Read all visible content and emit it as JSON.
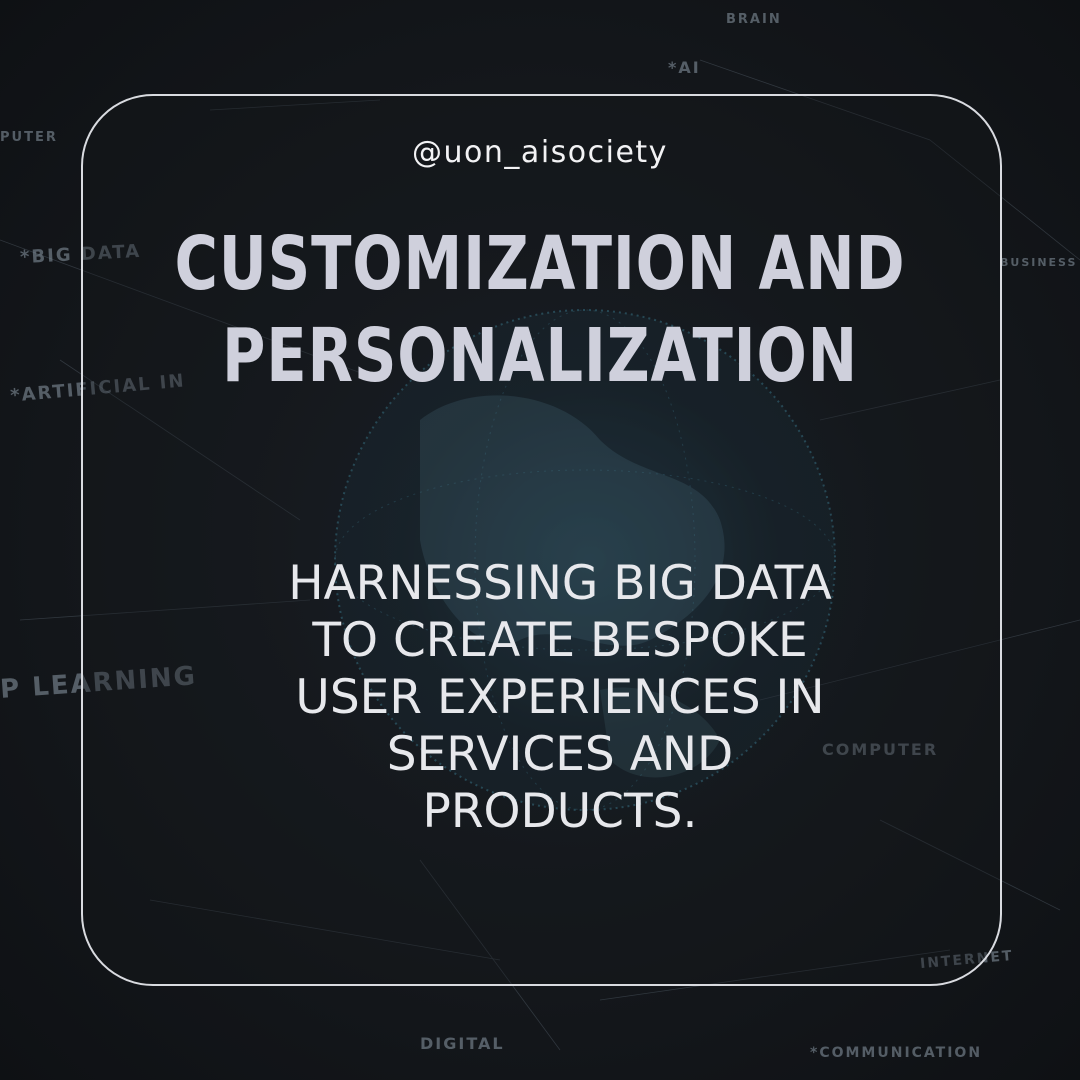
{
  "handle": "@uon_aisociety",
  "title_lines": [
    "CUSTOMIZATION AND",
    "PERSONALIZATION"
  ],
  "body_lines": [
    "HARNESSING BIG DATA",
    "TO CREATE BESPOKE",
    "USER EXPERIENCES IN",
    "SERVICES AND",
    "PRODUCTS."
  ],
  "background_words": {
    "brain_top": "BRAIN",
    "ai_top": "*AI",
    "puter_left": "PUTER",
    "big_data": "*BIG DATA",
    "artificial": "*ARTIFICIAL IN",
    "p_learning": "P LEARNING",
    "computer_right": "COMPUTER",
    "internet_right": "INTERNET",
    "digital_bottom": "DIGITAL",
    "communication_bottom": "*COMMUNICATION",
    "business_right": "BUSINESS"
  },
  "colors": {
    "background": "#13161a",
    "frame_border": "#d9dbe0",
    "title": "#cfd0dc",
    "text": "#e7e8ec"
  }
}
